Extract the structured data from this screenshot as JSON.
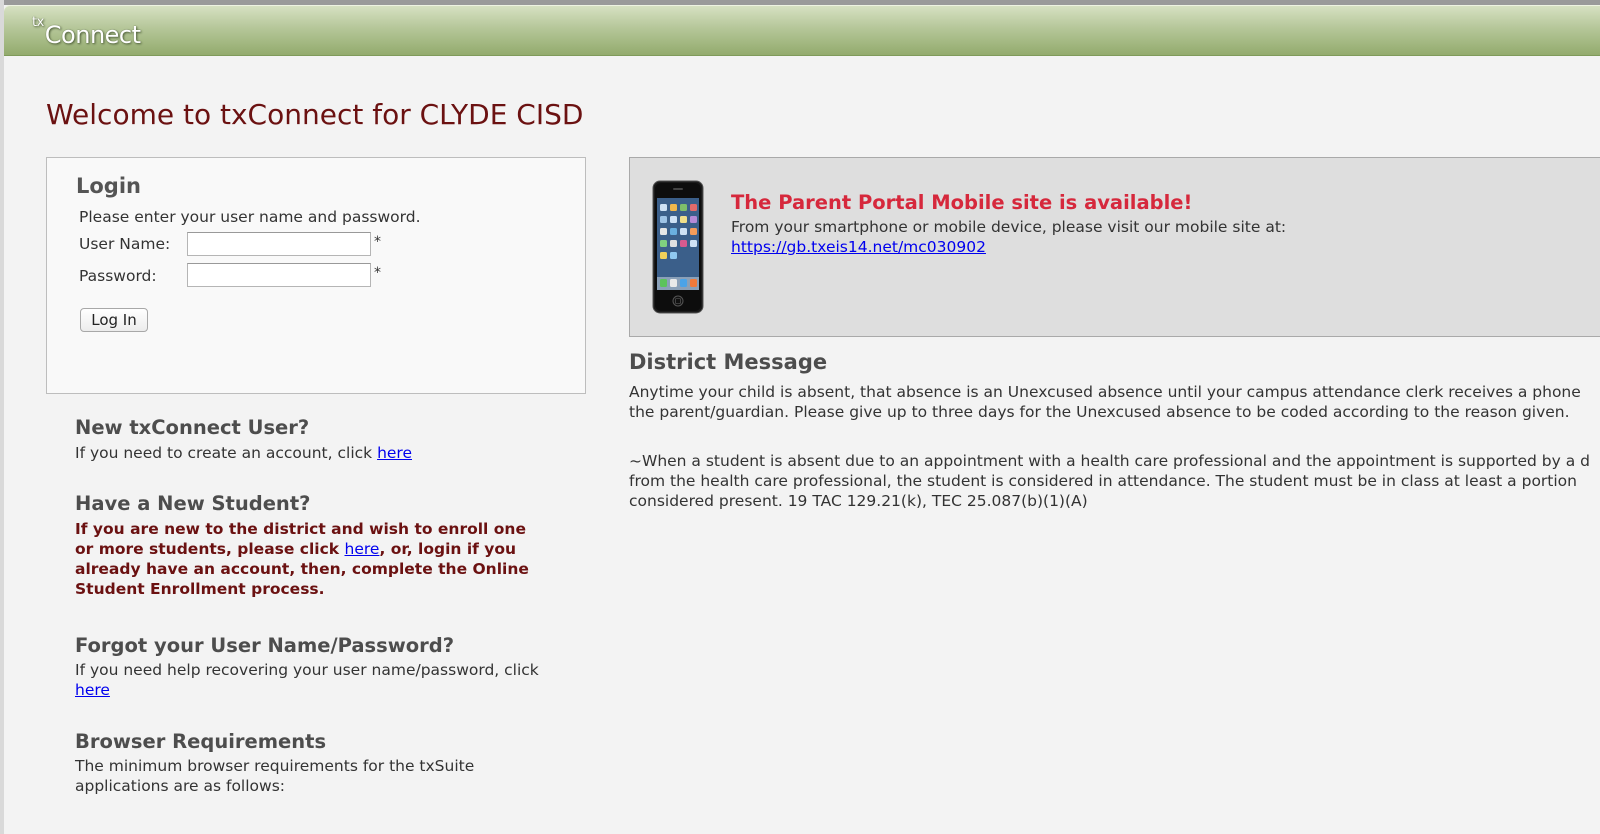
{
  "header": {
    "logo_prefix": "tx",
    "logo_text": "Connect"
  },
  "page": {
    "welcome": "Welcome to txConnect for CLYDE CISD"
  },
  "login": {
    "title": "Login",
    "instructions": "Please enter your user name and password.",
    "username_label": "User Name:",
    "password_label": "Password:",
    "username_value": "",
    "password_value": "",
    "required_marker": "*",
    "submit_label": "Log In"
  },
  "new_user": {
    "heading": "New txConnect User?",
    "text": "If you need to create an account, click ",
    "link": "here"
  },
  "new_student": {
    "heading": "Have a New Student?",
    "text_before": "If you are new to the district and wish to enroll one or more students, please click ",
    "link": "here",
    "text_after": ", or, login if you already have an account, then, complete the Online Student Enrollment process."
  },
  "forgot": {
    "heading": "Forgot your User Name/Password?",
    "text": "If you need help recovering your user name/password, click ",
    "link": "here"
  },
  "browser": {
    "heading": "Browser Requirements",
    "text": "The minimum browser requirements for the txSuite applications are as follows:"
  },
  "mobile": {
    "title": "The Parent Portal Mobile site is available!",
    "text": "From your smartphone or mobile device, please visit our mobile site at:",
    "link": "https://gb.txeis14.net/mc030902 "
  },
  "district": {
    "heading": "District Message",
    "lines": [
      "Anytime your child is absent, that absence is an Unexcused absence until your campus attendance clerk receives a phone",
      "the parent/guardian.  Please give up to three days for the Unexcused absence to be coded according to the reason given.",
      "~When a student is absent due to an appointment with a health care professional and the appointment is supported by a d",
      "from the health care professional, the student is considered in attendance. The student must be in class at least a portion",
      "considered present. 19 TAC 129.21(k), TEC 25.087(b)(1)(A)"
    ]
  },
  "colors": {
    "header_green": "#93ab6d",
    "welcome_maroon": "#6b1111",
    "mobile_title_red": "#d6283c",
    "link_blue": "#0000ee"
  }
}
